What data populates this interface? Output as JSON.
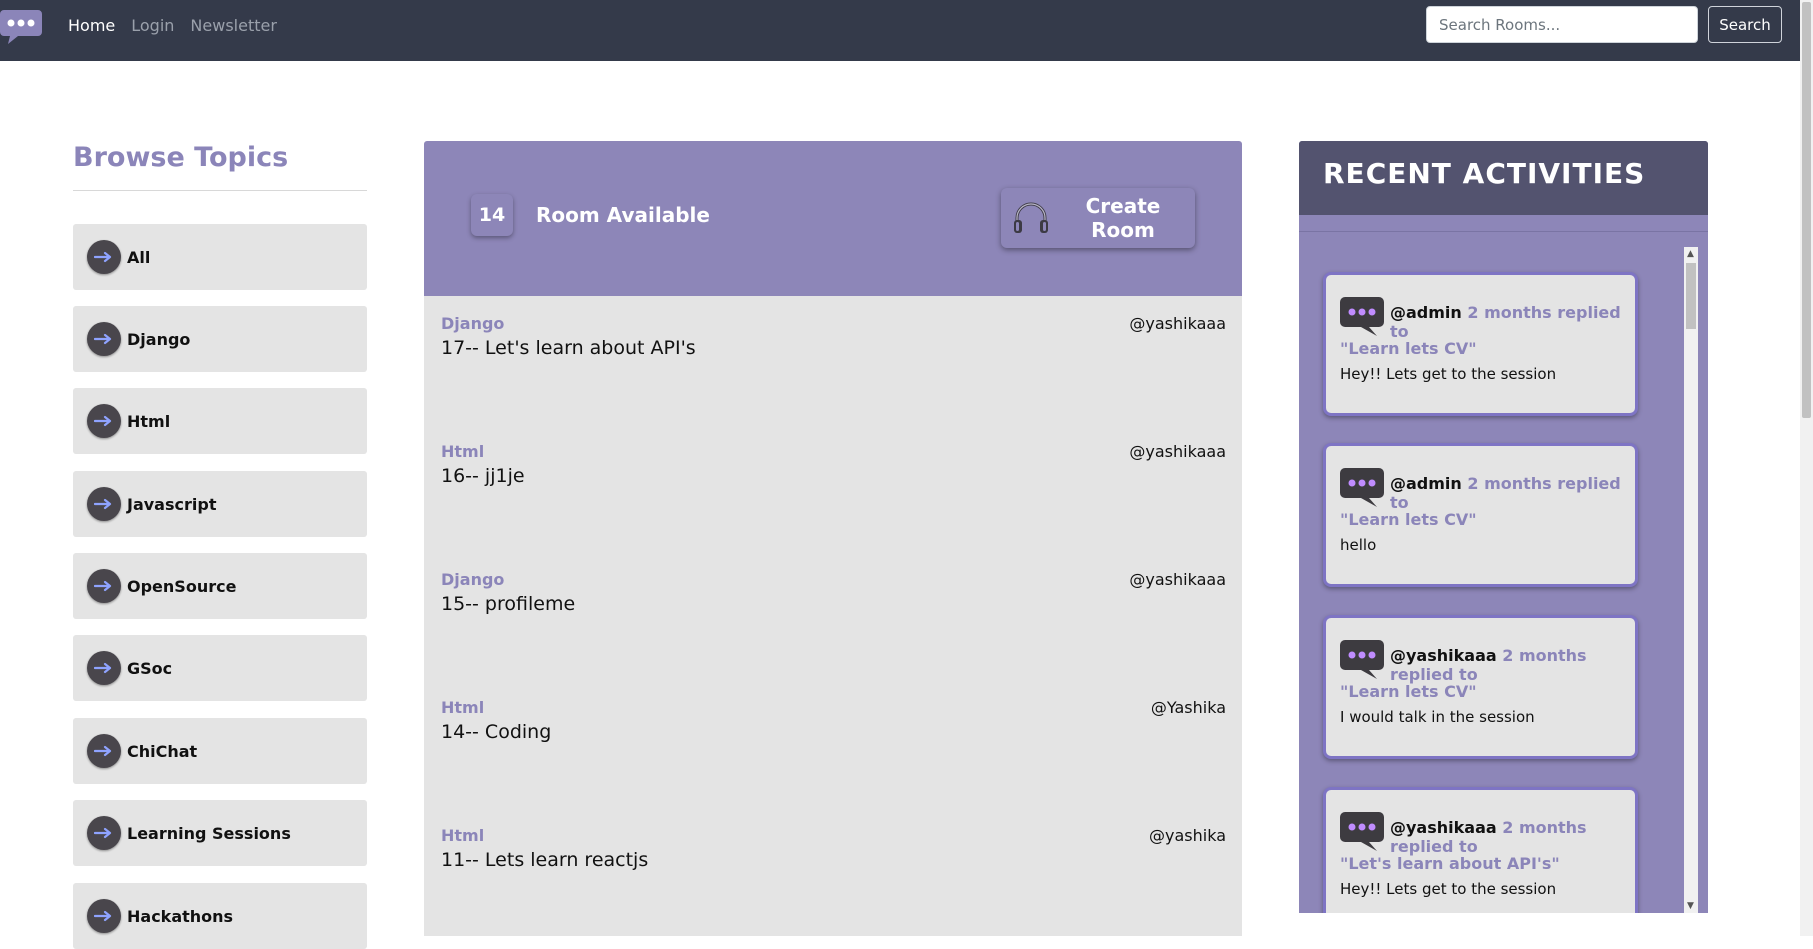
{
  "nav": {
    "links": [
      {
        "label": "Home",
        "active": true
      },
      {
        "label": "Login",
        "active": false
      },
      {
        "label": "Newsletter",
        "active": false
      }
    ],
    "search_placeholder": "Search Rooms...",
    "search_button": "Search"
  },
  "topics": {
    "title": "Browse Topics",
    "items": [
      {
        "label": "All"
      },
      {
        "label": "Django"
      },
      {
        "label": "Html"
      },
      {
        "label": "Javascript"
      },
      {
        "label": "OpenSource"
      },
      {
        "label": "GSoc"
      },
      {
        "label": "ChiChat"
      },
      {
        "label": "Learning Sessions"
      },
      {
        "label": "Hackathons"
      }
    ]
  },
  "rooms": {
    "count": "14",
    "available_label": "Room Available",
    "create_label": "Create Room",
    "items": [
      {
        "topic": "Django",
        "host": "@yashikaaa",
        "title": "17-- Let's learn about API's"
      },
      {
        "topic": "Html",
        "host": "@yashikaaa",
        "title": "16-- jj1je"
      },
      {
        "topic": "Django",
        "host": "@yashikaaa",
        "title": "15-- profileme"
      },
      {
        "topic": "Html",
        "host": "@Yashika",
        "title": "14-- Coding"
      },
      {
        "topic": "Html",
        "host": "@yashika",
        "title": "11-- Lets learn reactjs"
      }
    ]
  },
  "activities": {
    "title": "RECENT ACTIVITIES",
    "items": [
      {
        "user": "@admin",
        "meta": "2 months replied to",
        "room": "\"Learn lets CV\"",
        "message": "Hey!! Lets get to the session"
      },
      {
        "user": "@admin",
        "meta": "2 months replied to",
        "room": "\"Learn lets CV\"",
        "message": "hello"
      },
      {
        "user": "@yashikaaa",
        "meta": "2 months replied to",
        "room": "\"Learn lets CV\"",
        "message": "I would talk in the session"
      },
      {
        "user": "@yashikaaa",
        "meta": "2 months replied to",
        "room": "\"Let's learn about API's\"",
        "message": "Hey!! Lets get to the session"
      }
    ]
  },
  "colors": {
    "navbar": "#343a4a",
    "accent_purple": "#8d86b8",
    "activities_header": "#53536f",
    "card_bg": "#e4e4e4"
  },
  "icons": {
    "logo": "chat-bubble-logo-icon",
    "topic_arrow": "arrow-right-icon",
    "create_room": "headset-icon",
    "activity": "chat-bubble-icon"
  }
}
